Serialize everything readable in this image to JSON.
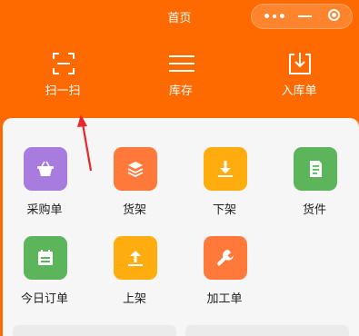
{
  "header": {
    "title": "首页",
    "capsule": {
      "more_icon": "more-dots-icon",
      "minimize_icon": "minimize-icon",
      "close_icon": "target-close-icon"
    }
  },
  "quick_actions": [
    {
      "label": "扫一扫",
      "icon": "scan-icon"
    },
    {
      "label": "库存",
      "icon": "menu-lines-icon"
    },
    {
      "label": "入库单",
      "icon": "inbound-download-icon"
    }
  ],
  "grid": [
    {
      "label": "采购单",
      "icon": "basket-icon",
      "color": "#a77cde"
    },
    {
      "label": "货架",
      "icon": "layers-icon",
      "color": "#ff7a3a"
    },
    {
      "label": "下架",
      "icon": "download-icon",
      "color": "#ffac0f"
    },
    {
      "label": "货件",
      "icon": "document-icon",
      "color": "#5cb55a"
    },
    {
      "label": "今日订单",
      "icon": "calendar-icon",
      "color": "#5cb55a"
    },
    {
      "label": "上架",
      "icon": "upload-icon",
      "color": "#ffac0f"
    },
    {
      "label": "加工单",
      "icon": "wrench-icon",
      "color": "#ff7a3a"
    }
  ],
  "colors": {
    "brand": "#ff6a00",
    "card_bg": "#f6f6f6",
    "annotation_arrow": "#e8272b"
  }
}
